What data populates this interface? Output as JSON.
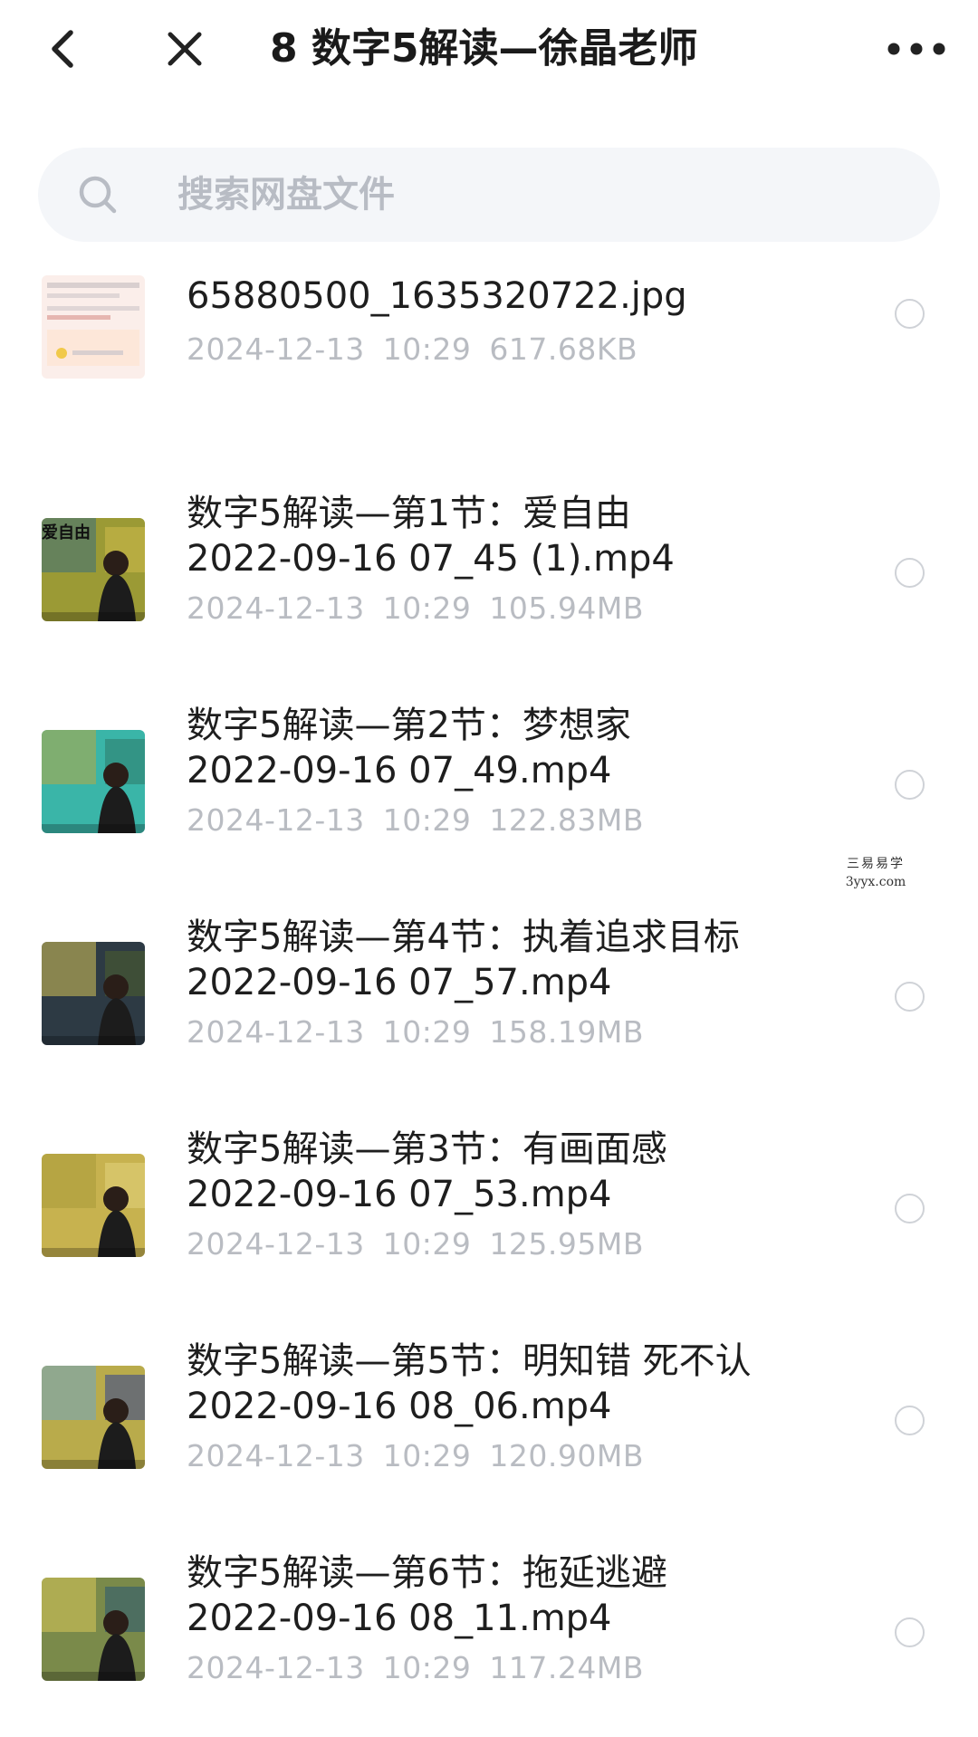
{
  "header": {
    "title": "8 数字5解读—徐晶老师",
    "back_icon": "chevron-left-icon",
    "close_icon": "close-icon",
    "more_icon": "more-dots-icon"
  },
  "search": {
    "placeholder": "搜索网盘文件",
    "icon": "search-icon"
  },
  "files": [
    {
      "name": "65880500_1635320722.jpg",
      "date": "2024-12-13",
      "time": "10:29",
      "size": "617.68KB",
      "thumb": "document"
    },
    {
      "name": "数字5解读—第1节：爱自由\n2022-09-16 07_45 (1).mp4",
      "date": "2024-12-13",
      "time": "10:29",
      "size": "105.94MB",
      "thumb": "video",
      "caption": "爱自由"
    },
    {
      "name": "数字5解读—第2节：梦想家\n2022-09-16 07_49.mp4",
      "date": "2024-12-13",
      "time": "10:29",
      "size": "122.83MB",
      "thumb": "video"
    },
    {
      "name": "数字5解读—第4节：执着追求目标\n2022-09-16 07_57.mp4",
      "date": "2024-12-13",
      "time": "10:29",
      "size": "158.19MB",
      "thumb": "video"
    },
    {
      "name": "数字5解读—第3节：有画面感\n2022-09-16 07_53.mp4",
      "date": "2024-12-13",
      "time": "10:29",
      "size": "125.95MB",
      "thumb": "video"
    },
    {
      "name": "数字5解读—第5节：明知错 死不认\n2022-09-16 08_06.mp4",
      "date": "2024-12-13",
      "time": "10:29",
      "size": "120.90MB",
      "thumb": "video"
    },
    {
      "name": "数字5解读—第6节：拖延逃避\n2022-09-16 08_11.mp4",
      "date": "2024-12-13",
      "time": "10:29",
      "size": "117.24MB",
      "thumb": "video"
    }
  ],
  "watermark": {
    "line1": "三易易学",
    "line2": "3yyx.com"
  },
  "colors": {
    "title": "#1a1a1a",
    "meta": "#b9bcc2",
    "search_bg": "#f4f6f9",
    "radio_border": "#cfd2d7"
  }
}
